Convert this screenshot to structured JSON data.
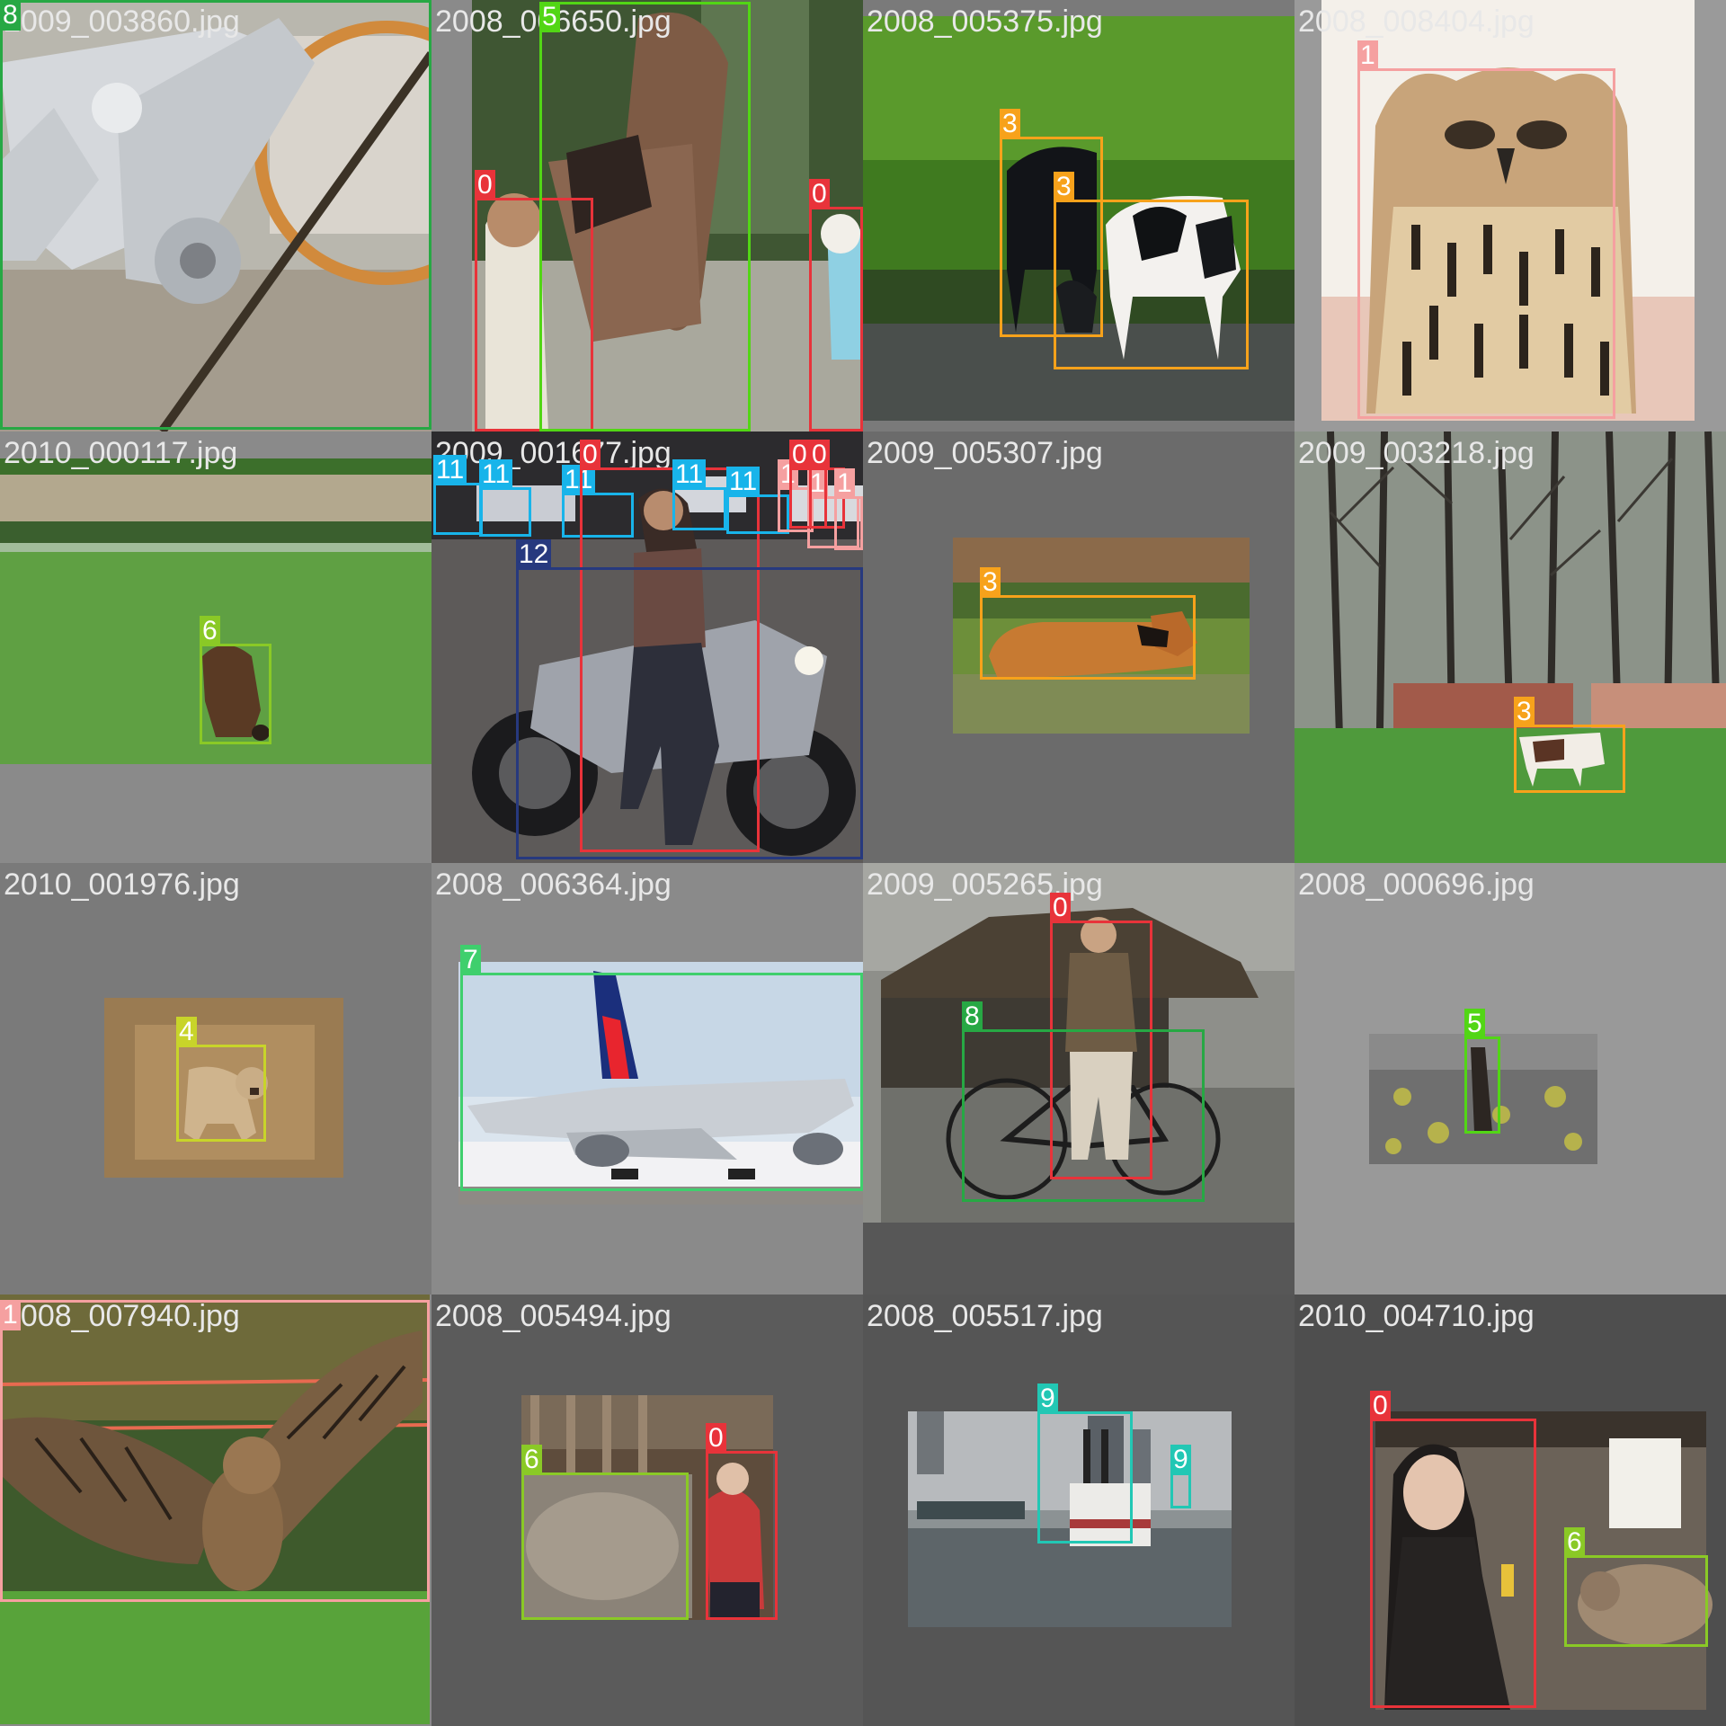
{
  "colors": {
    "0": "#e8333a",
    "1": "#f5a0a0",
    "3": "#f7a21b",
    "4": "#c8d42a",
    "5": "#52d615",
    "6": "#8ac926",
    "7": "#3fcf6d",
    "8": "#27a844",
    "9": "#22c7b4",
    "11": "#18b4ea",
    "12": "#27397e"
  },
  "tiles": [
    {
      "filename": "2009_003860.jpg",
      "bg": "#8a8a8a",
      "photo": "bike",
      "boxes": [
        {
          "cls": "8"
        }
      ]
    },
    {
      "filename": "2008_006650.jpg",
      "bg": "#8a8a8a",
      "photo": "horse",
      "boxes": [
        {
          "cls": "0"
        },
        {
          "cls": "5"
        },
        {
          "cls": "0"
        }
      ]
    },
    {
      "filename": "2008_005375.jpg",
      "bg": "#6e6e6e",
      "photo": "cows",
      "boxes": [
        {
          "cls": "3"
        },
        {
          "cls": "3"
        }
      ]
    },
    {
      "filename": "2008_008404.jpg",
      "bg": "#9a9a9a",
      "photo": "owl",
      "boxes": [
        {
          "cls": "1"
        }
      ]
    },
    {
      "filename": "2010_000117.jpg",
      "bg": "#8a8a8a",
      "photo": "field",
      "boxes": [
        {
          "cls": "6"
        }
      ]
    },
    {
      "filename": "2009_001677.jpg",
      "bg": "#666666",
      "photo": "moto",
      "boxes": [
        {
          "cls": "11"
        },
        {
          "cls": "11"
        },
        {
          "cls": "11"
        },
        {
          "cls": "0"
        },
        {
          "cls": "11"
        },
        {
          "cls": "11"
        },
        {
          "cls": "1"
        },
        {
          "cls": "1"
        },
        {
          "cls": "0"
        },
        {
          "cls": "0"
        },
        {
          "cls": "1"
        },
        {
          "cls": "12"
        }
      ]
    },
    {
      "filename": "2009_005307.jpg",
      "bg": "#6b6b6b",
      "photo": "cow-lying",
      "boxes": [
        {
          "cls": "3"
        }
      ]
    },
    {
      "filename": "2009_003218.jpg",
      "bg": "#8a8a8a",
      "photo": "trees",
      "boxes": [
        {
          "cls": "3"
        }
      ]
    },
    {
      "filename": "2010_001976.jpg",
      "bg": "#7a7a7a",
      "photo": "dog",
      "boxes": [
        {
          "cls": "4"
        }
      ]
    },
    {
      "filename": "2008_006364.jpg",
      "bg": "#8a8a8a",
      "photo": "plane",
      "boxes": [
        {
          "cls": "7"
        }
      ]
    },
    {
      "filename": "2009_005265.jpg",
      "bg": "#575757",
      "photo": "cyclist",
      "boxes": [
        {
          "cls": "0"
        },
        {
          "cls": "8"
        }
      ]
    },
    {
      "filename": "2008_000696.jpg",
      "bg": "#999999",
      "photo": "bw-horse",
      "boxes": [
        {
          "cls": "5"
        }
      ]
    },
    {
      "filename": "2008_007940.jpg",
      "bg": "#8a8a8a",
      "photo": "owl-flight",
      "boxes": [
        {
          "cls": "1"
        }
      ]
    },
    {
      "filename": "2008_005494.jpg",
      "bg": "#5b5b5b",
      "photo": "barn",
      "boxes": [
        {
          "cls": "6"
        },
        {
          "cls": "0"
        }
      ]
    },
    {
      "filename": "2008_005517.jpg",
      "bg": "#555555",
      "photo": "boat",
      "boxes": [
        {
          "cls": "9"
        },
        {
          "cls": "9"
        }
      ]
    },
    {
      "filename": "2010_004710.jpg",
      "bg": "#4e4e4e",
      "photo": "woman-ram",
      "boxes": [
        {
          "cls": "0"
        },
        {
          "cls": "6"
        }
      ]
    }
  ]
}
